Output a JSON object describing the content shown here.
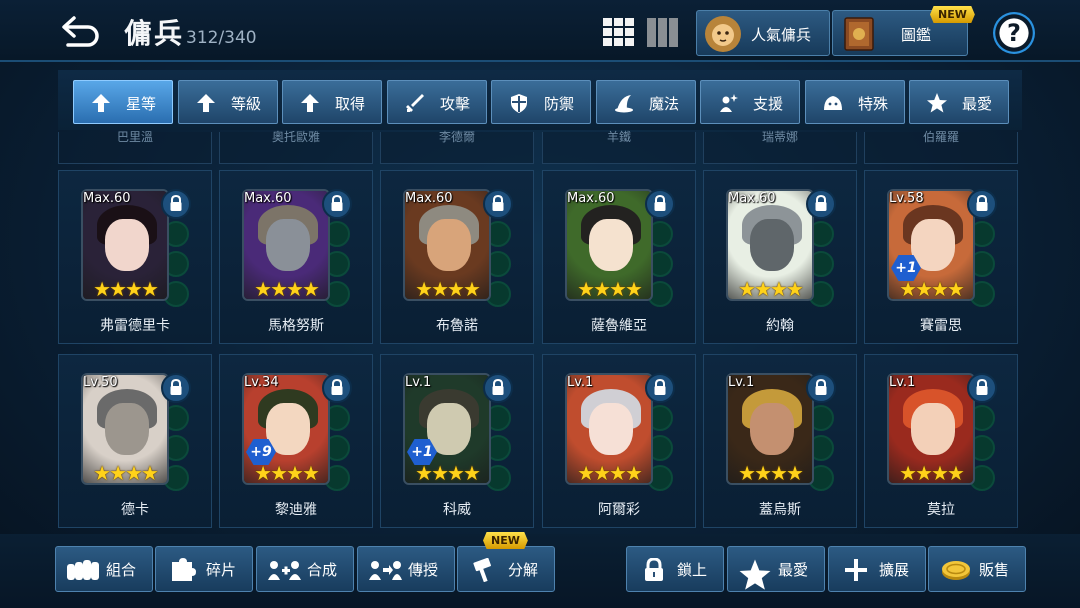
{
  "header": {
    "title": "傭兵",
    "count": "312/340",
    "popular_label": "人氣傭兵",
    "catalog_label": "圖鑑",
    "new_badge": "NEW",
    "help_symbol": "?"
  },
  "tabs": [
    {
      "label": "星等",
      "icon": "arrow-up-icon",
      "active": true
    },
    {
      "label": "等級",
      "icon": "arrow-up-icon",
      "active": false
    },
    {
      "label": "取得",
      "icon": "arrow-up-icon",
      "active": false
    },
    {
      "label": "攻擊",
      "icon": "sword-icon",
      "active": false
    },
    {
      "label": "防禦",
      "icon": "shield-icon",
      "active": false
    },
    {
      "label": "魔法",
      "icon": "wizard-hat-icon",
      "active": false
    },
    {
      "label": "支援",
      "icon": "sparkle-person-icon",
      "active": false
    },
    {
      "label": "特殊",
      "icon": "slime-icon",
      "active": false
    },
    {
      "label": "最愛",
      "icon": "star-icon",
      "active": false
    }
  ],
  "ghost_row": [
    "巴里溫",
    "奧托歐雅",
    "李德爾",
    "羊鐵",
    "瑞蒂娜",
    "伯羅羅"
  ],
  "mercenaries": [
    {
      "name": "弗雷德里卡",
      "level": "Max.60",
      "stars": 4,
      "plus": "",
      "bg": "#2a2238",
      "hair": "#1a1016",
      "skin": "#f1d6cc"
    },
    {
      "name": "馬格努斯",
      "level": "Max.60",
      "stars": 4,
      "plus": "",
      "bg": "#4a2a78",
      "hair": "#7c7468",
      "skin": "#8a9098"
    },
    {
      "name": "布魯諾",
      "level": "Max.60",
      "stars": 4,
      "plus": "",
      "bg": "#6a3a20",
      "hair": "#8e8a80",
      "skin": "#d8a47a"
    },
    {
      "name": "薩魯維亞",
      "level": "Max.60",
      "stars": 4,
      "plus": "",
      "bg": "#3f6a2a",
      "hair": "#232220",
      "skin": "#f5e2cf"
    },
    {
      "name": "約翰",
      "level": "Max.60",
      "stars": 4,
      "plus": "",
      "bg": "#e8efe4",
      "hair": "#8d9498",
      "skin": "#5f666a"
    },
    {
      "name": "賽雷思",
      "level": "Lv.58",
      "stars": 4,
      "plus": "+1",
      "bg": "#c76a3a",
      "hair": "#6a3620",
      "skin": "#f4d5c0"
    },
    {
      "name": "德卡",
      "level": "Lv.50",
      "stars": 4,
      "plus": "",
      "bg": "#d8d0c8",
      "hair": "#6a6a6a",
      "skin": "#9c968e"
    },
    {
      "name": "黎迪雅",
      "level": "Lv.34",
      "stars": 4,
      "plus": "+9",
      "bg": "#b8402e",
      "hair": "#2f3a20",
      "skin": "#f3d7c0"
    },
    {
      "name": "科威",
      "level": "Lv.1",
      "stars": 4,
      "plus": "+1",
      "bg": "#1f3a2a",
      "hair": "#3a3a30",
      "skin": "#cfcab0"
    },
    {
      "name": "阿爾彩",
      "level": "Lv.1",
      "stars": 4,
      "plus": "",
      "bg": "#c04d2e",
      "hair": "#d0cfd4",
      "skin": "#f6e0d6"
    },
    {
      "name": "蓋烏斯",
      "level": "Lv.1",
      "stars": 4,
      "plus": "",
      "bg": "#3a2818",
      "hair": "#c49a3a",
      "skin": "#c49070"
    },
    {
      "name": "莫拉",
      "level": "Lv.1",
      "stars": 4,
      "plus": "",
      "bg": "#9a2a1e",
      "hair": "#d8532a",
      "skin": "#f3d0b8"
    }
  ],
  "bottom_left": [
    {
      "label": "組合",
      "icon": "group-icon"
    },
    {
      "label": "碎片",
      "icon": "puzzle-piece-icon"
    },
    {
      "label": "合成",
      "icon": "merge-icon"
    },
    {
      "label": "傳授",
      "icon": "transfer-icon"
    },
    {
      "label": "分解",
      "icon": "hammer-icon",
      "badge": "NEW"
    }
  ],
  "bottom_right": [
    {
      "label": "鎖上",
      "icon": "lock-icon"
    },
    {
      "label": "最愛",
      "icon": "star-icon"
    },
    {
      "label": "擴展",
      "icon": "plus-icon"
    },
    {
      "label": "販售",
      "icon": "coin-icon"
    }
  ]
}
